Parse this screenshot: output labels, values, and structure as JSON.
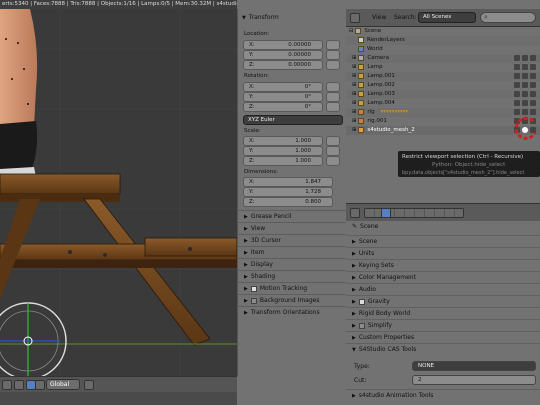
{
  "statusbar": {
    "text": "erts:5340 | Faces:7888 | Tris:7888 | Objects:1/16 | Lamps:0/5 | Mem:30.32M | s4studio_mesh_2"
  },
  "viewport": {
    "transform_select": "Global"
  },
  "npanel": {
    "transform_title": "Transform",
    "location_label": "Location:",
    "location": [
      {
        "k": "X:",
        "v": "0.00000"
      },
      {
        "k": "Y:",
        "v": "0.00000"
      },
      {
        "k": "Z:",
        "v": "0.00000"
      }
    ],
    "rotation_label": "Rotation:",
    "rotation": [
      {
        "k": "X:",
        "v": "0°"
      },
      {
        "k": "Y:",
        "v": "0°"
      },
      {
        "k": "Z:",
        "v": "0°"
      }
    ],
    "rotation_mode": "XYZ Euler",
    "scale_label": "Scale:",
    "scale": [
      {
        "k": "X:",
        "v": "1.000"
      },
      {
        "k": "Y:",
        "v": "1.000"
      },
      {
        "k": "Z:",
        "v": "1.000"
      }
    ],
    "dimensions_label": "Dimensions:",
    "dimensions": [
      {
        "k": "X:",
        "v": "1.847"
      },
      {
        "k": "Y:",
        "v": "1.728"
      },
      {
        "k": "Z:",
        "v": "0.800"
      }
    ],
    "sub_panels": [
      "Grease Pencil",
      "View",
      "3D Cursor",
      "Item",
      "Display",
      "Shading",
      "Motion Tracking",
      "Background Images",
      "Transform Orientations"
    ]
  },
  "outliner": {
    "view_label": "View",
    "search_label": "Search:",
    "scene_select": "All Scenes",
    "rows": [
      "Scene",
      "RenderLayers",
      "World",
      "Camera",
      "Lamp",
      "Lamp.001",
      "Lamp.002",
      "Lamp.003",
      "Lamp.004",
      "rig",
      "rig.001",
      "s4studio_mesh_2"
    ],
    "tooltip": {
      "line1": "Restrict viewport selection (Ctrl - Recursive)",
      "line2": "Python: Object.hide_select",
      "line3": "bpy.data.objects[\"s4studio_mesh_2\"].hide_select"
    }
  },
  "properties": {
    "scene_label": "Scene",
    "panels": [
      "Scene",
      "Units",
      "Keying Sets",
      "Color Management",
      "Audio",
      "Gravity",
      "Rigid Body World",
      "Simplify",
      "Custom Properties"
    ],
    "cas_title": "S4Studio CAS Tools",
    "type_label": "Type:",
    "type_value": "NONE",
    "cut_label": "Cut:",
    "cut_value": "2",
    "anim_tools": "s4studio Animation Tools"
  },
  "colors": {
    "accent": "#5680c2",
    "timeline_red": "#d03030"
  }
}
